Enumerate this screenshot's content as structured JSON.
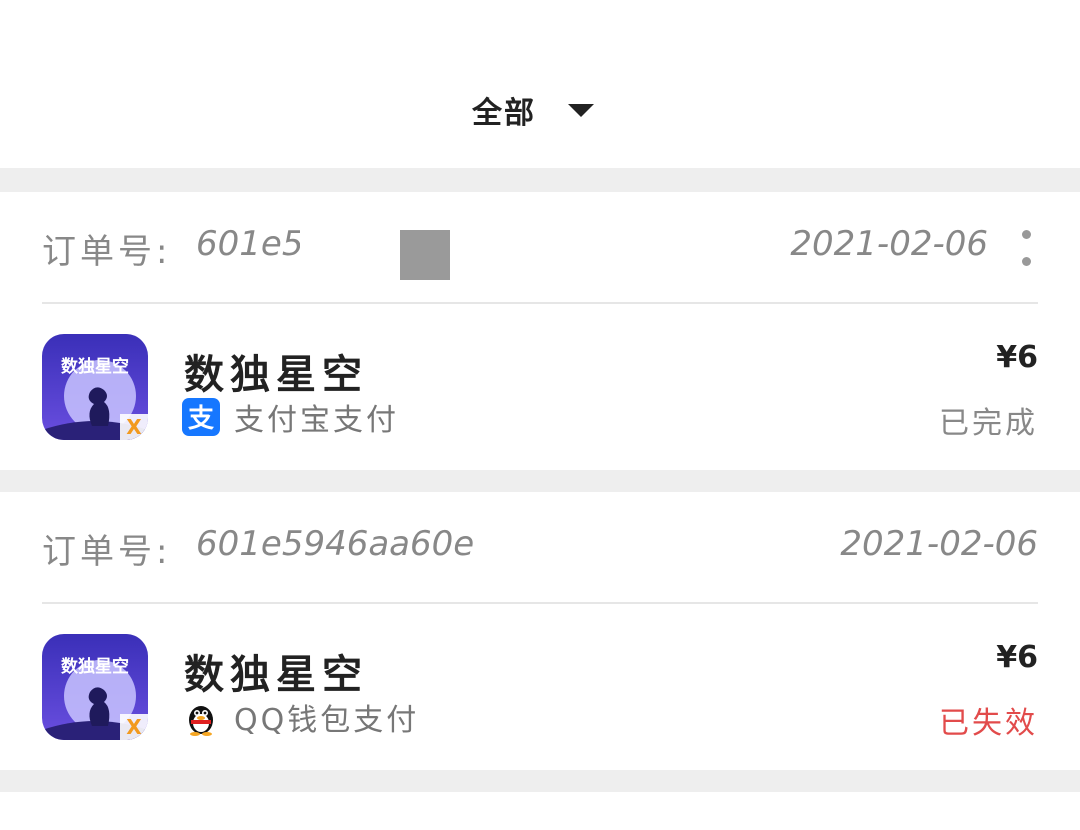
{
  "filter": {
    "label": "全部"
  },
  "orders": [
    {
      "order_label": "订单号:",
      "order_no": "601e5a",
      "date": "2021-02-06",
      "app_name": "数独星空",
      "payment": {
        "label": "支付宝支付",
        "icon": "alipay-icon",
        "color": "#1677ff"
      },
      "price": "¥6",
      "status": "已完成",
      "status_color": "#888888"
    },
    {
      "order_label": "订单号:",
      "order_no": "601e5946aa60e",
      "date": "2021-02-06",
      "app_name": "数独星空",
      "payment": {
        "label": "QQ钱包支付",
        "icon": "qq-penguin-icon"
      },
      "price": "¥6",
      "status": "已失效",
      "status_color": "#e24b4b"
    }
  ],
  "app_icon": {
    "name": "sudoku-starry-sky-app-icon",
    "icon_text": "数独星空"
  }
}
